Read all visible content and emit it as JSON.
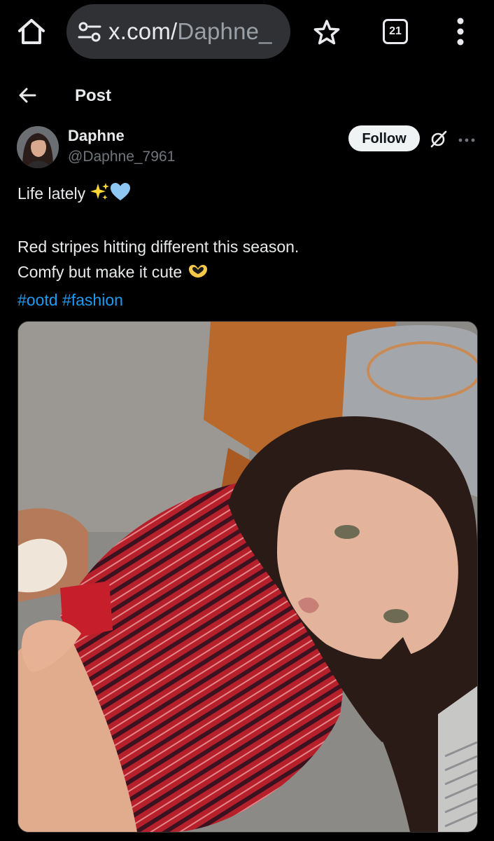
{
  "browser": {
    "url_host": "x.com/",
    "url_path": "Daphne_",
    "tab_count": "21",
    "icons": [
      "home-icon",
      "site-settings-icon",
      "star-icon",
      "tabs-icon",
      "more-vert-icon"
    ]
  },
  "header": {
    "title": "Post",
    "back_icon": "arrow-left-icon"
  },
  "author": {
    "display_name": "Daphne",
    "handle": "@Daphne_7961",
    "follow_label": "Follow"
  },
  "post": {
    "line1": "Life lately",
    "line2": "Red stripes hitting different this season.",
    "line3": "Comfy but make it cute",
    "hashtag1": "#ootd",
    "hashtag2": "#fashion",
    "emojis": [
      "sparkles",
      "light-blue-heart",
      "heart-hands"
    ]
  },
  "colors": {
    "background": "#000000",
    "text": "#e7e9ea",
    "secondary_text": "#71767b",
    "link": "#1d9bf0",
    "url_bar": "#303134"
  }
}
